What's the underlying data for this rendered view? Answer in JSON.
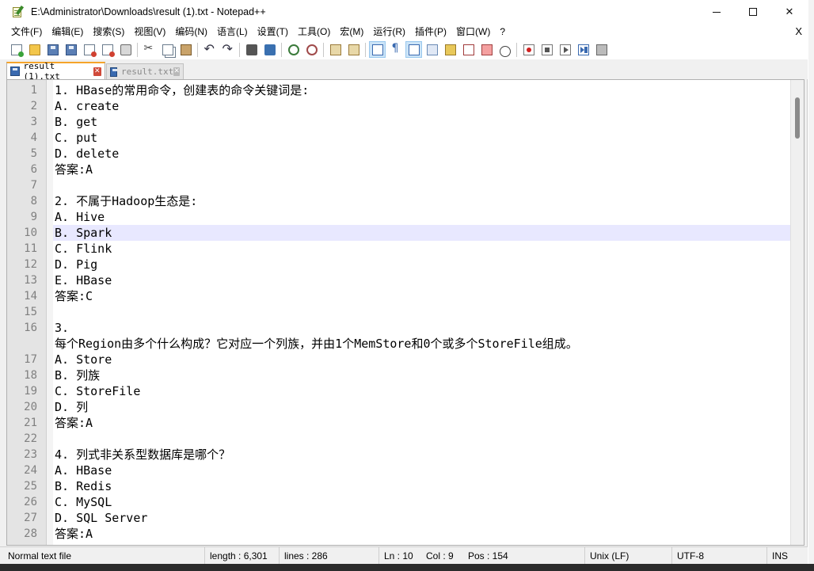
{
  "window": {
    "title": "E:\\Administrator\\Downloads\\result (1).txt - Notepad++",
    "minimize_icon": "minimize-icon",
    "maximize_icon": "maximize-icon",
    "close_glyph": "✕"
  },
  "menu": {
    "items": [
      "文件(F)",
      "编辑(E)",
      "搜索(S)",
      "视图(V)",
      "编码(N)",
      "语言(L)",
      "设置(T)",
      "工具(O)",
      "宏(M)",
      "运行(R)",
      "插件(P)",
      "窗口(W)",
      "?"
    ],
    "close_label": "X"
  },
  "toolbar": {
    "icons": [
      "new-file-icon",
      "open-file-icon",
      "save-icon",
      "save-all-icon",
      "close-icon",
      "close-all-icon",
      "print-icon",
      "cut-icon",
      "copy-icon",
      "paste-icon",
      "undo-icon",
      "redo-icon",
      "find-icon",
      "replace-icon",
      "zoom-in-icon",
      "zoom-out-icon",
      "sync-vertical-icon",
      "sync-horizontal-icon",
      "word-wrap-icon",
      "show-all-characters-icon",
      "indent-guide-icon",
      "user-language-icon",
      "document-map-icon",
      "function-list-icon",
      "folder-as-workspace-icon",
      "monitoring-icon",
      "record-macro-icon",
      "stop-macro-icon",
      "play-macro-icon",
      "run-macro-multiple-icon",
      "save-macro-icon"
    ]
  },
  "tabs": [
    {
      "label": "result (1).txt",
      "active": true
    },
    {
      "label": "result.txt",
      "active": false
    }
  ],
  "editor": {
    "line_numbers": [
      "1",
      "2",
      "3",
      "4",
      "5",
      "6",
      "7",
      "8",
      "9",
      "10",
      "11",
      "12",
      "13",
      "14",
      "15",
      "16",
      "",
      "17",
      "18",
      "19",
      "20",
      "21",
      "22",
      "23",
      "24",
      "25",
      "26",
      "27",
      "28"
    ],
    "lines": [
      "1. HBase的常用命令，创建表的命令关键词是:",
      "A. create",
      "B. get",
      "C. put",
      "D. delete",
      "答案:A",
      "",
      "2. 不属于Hadoop生态是:",
      "A. Hive",
      "B. Spark",
      "C. Flink",
      "D. Pig",
      "E. HBase",
      "答案:C",
      "",
      "3.",
      "每个Region由多个什么构成？它对应一个列族，并由1个MemStore和0个或多个StoreFile组成。",
      "A. Store",
      "B. 列族",
      "C. StoreFile",
      "D. 列",
      "答案:A",
      "",
      "4. 列式非关系型数据库是哪个？",
      "A. HBase",
      "B. Redis",
      "C. MySQL",
      "D. SQL Server",
      "答案:A"
    ],
    "current_line_index": 9
  },
  "status": {
    "file_type": "Normal text file",
    "length": "length : 6,301",
    "lines": "lines : 286",
    "ln": "Ln : 10",
    "col": "Col : 9",
    "pos": "Pos : 154",
    "eol": "Unix (LF)",
    "encoding": "UTF-8",
    "mode": "INS"
  }
}
